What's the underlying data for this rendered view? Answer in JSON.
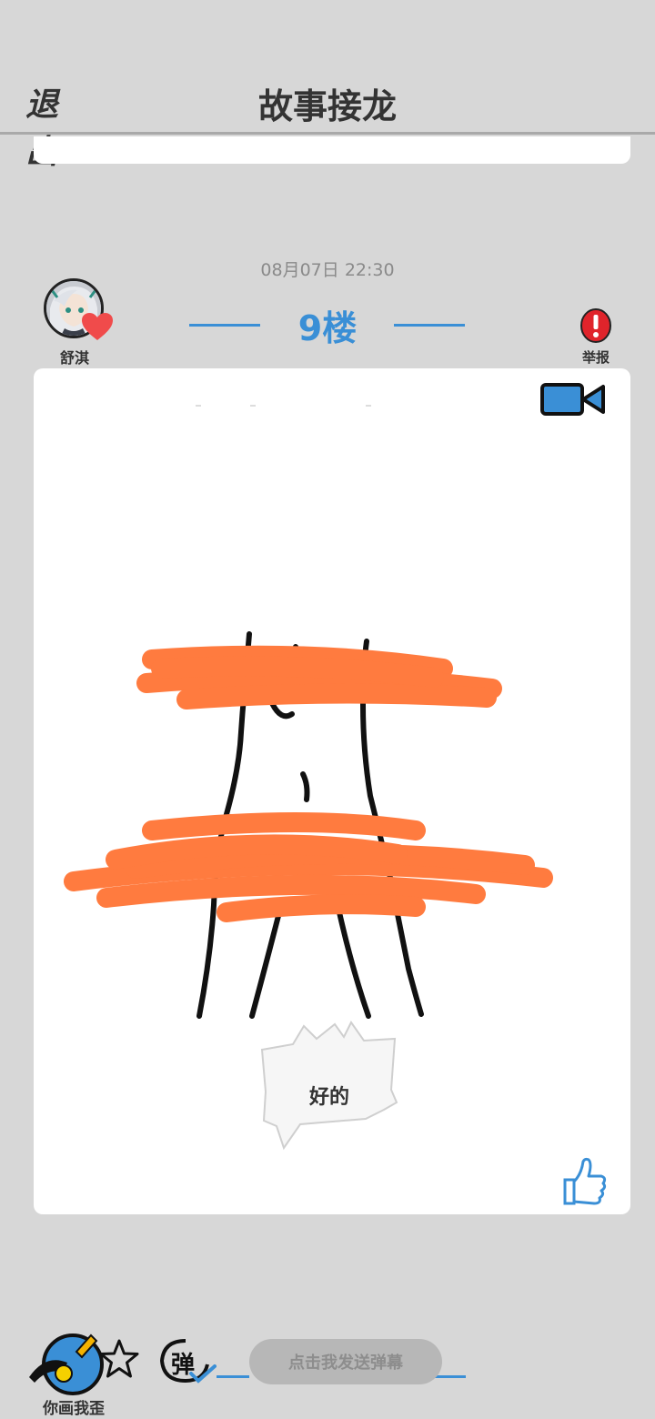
{
  "header": {
    "exit_label": "退出",
    "title": "故事接龙"
  },
  "post": {
    "timestamp": "08月07日  22:30",
    "floor": "9楼",
    "author": {
      "name": "舒淇"
    },
    "report_label": "举报",
    "speech_bubble": "好的"
  },
  "bottom": {
    "app_name": "你画我歪",
    "danmaku_placeholder": "点击我发送弹幕",
    "danmaku_toggle_glyph": "弹"
  },
  "colors": {
    "background": "#d7d7d7",
    "accent_blue": "#3a8fd6",
    "scribble_orange": "#ff7b3f",
    "report_red": "#e0242b"
  },
  "icons": {
    "video": "video-camera-icon",
    "like": "thumbs-up-icon",
    "heart": "heart-icon",
    "report": "exclamation-icon",
    "star": "star-icon"
  }
}
